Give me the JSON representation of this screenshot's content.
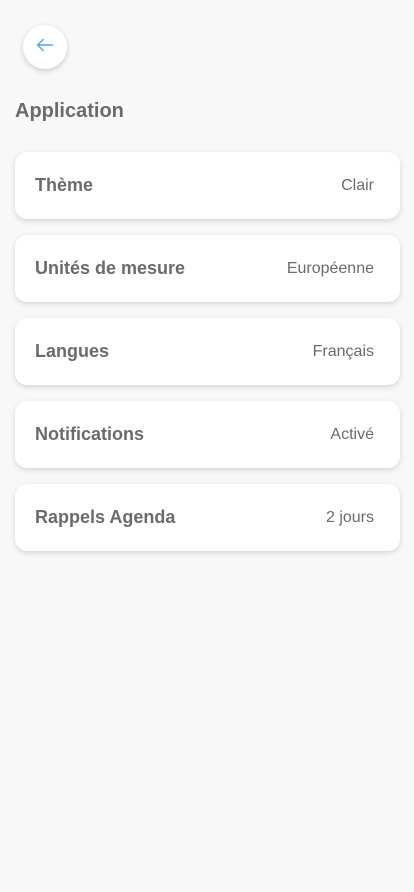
{
  "colors": {
    "background": "#f8f8f8",
    "card": "#ffffff",
    "text": "#6b6b6b",
    "accent": "#5aa6e0"
  },
  "header": {
    "back_icon": "arrow-left-icon"
  },
  "section": {
    "title": "Application"
  },
  "settings": [
    {
      "label": "Thème",
      "value": "Clair"
    },
    {
      "label": "Unités de mesure",
      "value": "Européenne"
    },
    {
      "label": "Langues",
      "value": "Français"
    },
    {
      "label": "Notifications",
      "value": "Activé"
    },
    {
      "label": "Rappels Agenda",
      "value": "2 jours"
    }
  ]
}
